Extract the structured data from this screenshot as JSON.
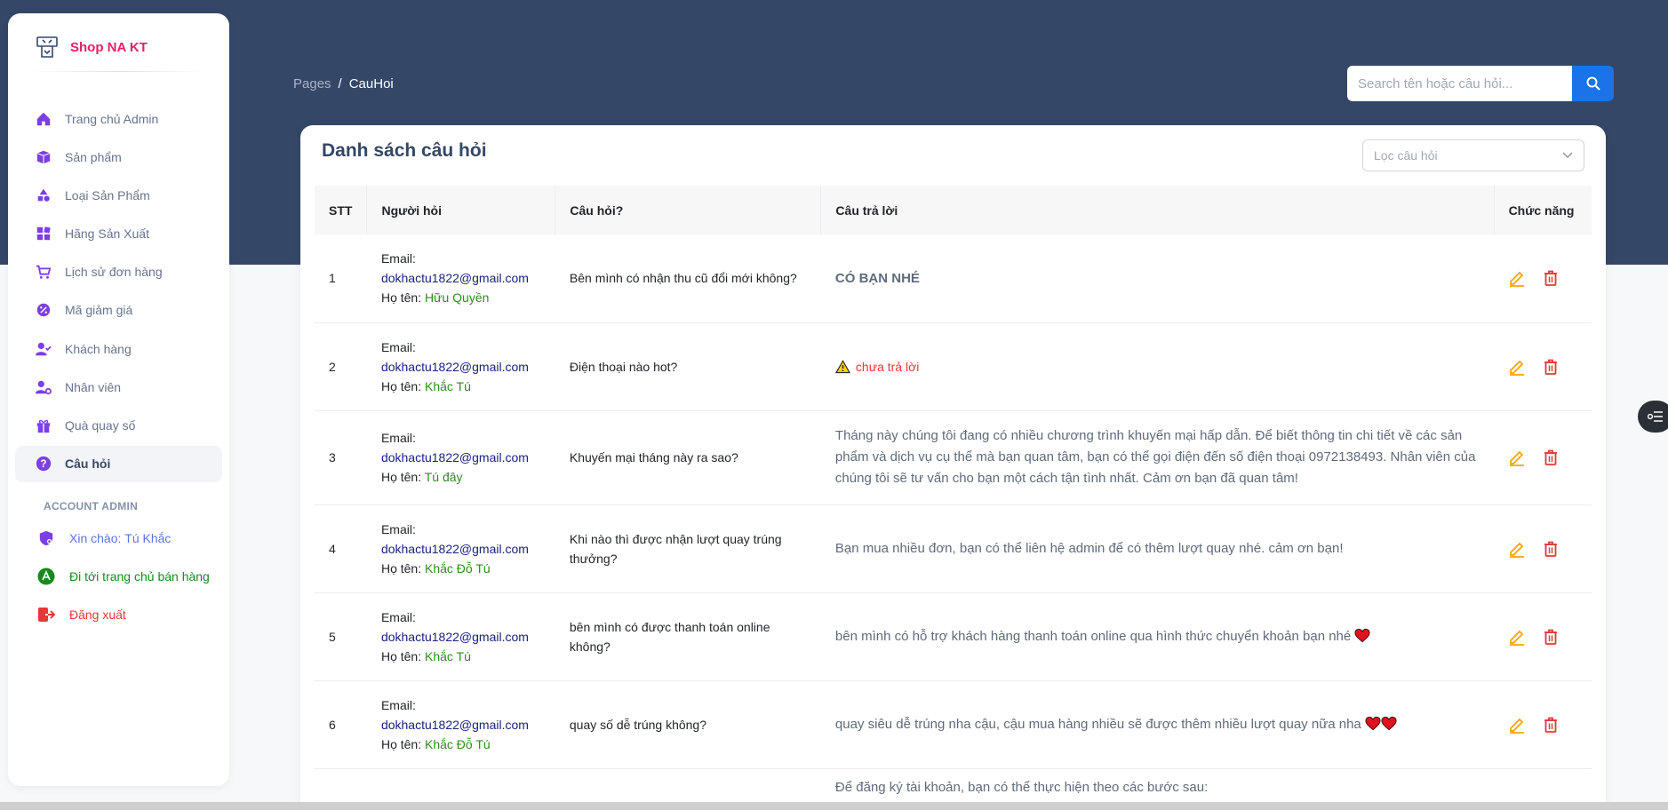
{
  "brand": {
    "name": "Shop NA KT"
  },
  "sidebar": {
    "items": [
      {
        "label": "Trang chủ Admin",
        "icon": "home-icon"
      },
      {
        "label": "Sản phẩm",
        "icon": "box-icon"
      },
      {
        "label": "Loại Sản Phẩm",
        "icon": "shapes-icon"
      },
      {
        "label": "Hãng Sản Xuất",
        "icon": "grid-icon"
      },
      {
        "label": "Lịch sử đơn hàng",
        "icon": "cart-icon"
      },
      {
        "label": "Mã giảm giá",
        "icon": "discount-icon"
      },
      {
        "label": "Khách hàng",
        "icon": "user-check-icon"
      },
      {
        "label": "Nhân viên",
        "icon": "user-gear-icon"
      },
      {
        "label": "Quà quay số",
        "icon": "gift-icon"
      },
      {
        "label": "Câu hỏi",
        "icon": "question-icon",
        "active": true
      }
    ],
    "account_section": "ACCOUNT ADMIN",
    "account": {
      "greeting_prefix": "Xin chào: ",
      "greeting_name": "Tú Khắc",
      "store_link": "Đi tới trang chủ bán hàng",
      "logout": "Đăng xuất"
    }
  },
  "breadcrumb": {
    "pages": "Pages",
    "sep": "/",
    "current": "CauHoi"
  },
  "search": {
    "placeholder": "Search tên hoặc câu hỏi..."
  },
  "card": {
    "title": "Danh sách câu hỏi",
    "filter_placeholder": "Lọc câu hỏi"
  },
  "table": {
    "headers": {
      "stt": "STT",
      "user": "Người hỏi",
      "question": "Câu hỏi?",
      "answer": "Câu trả lời",
      "actions": "Chức năng"
    },
    "email_label": "Email:",
    "name_label": "Họ tên: ",
    "rows": [
      {
        "stt": "1",
        "email": "dokhactu1822@gmail.com",
        "name": "Hữu Quyền",
        "question": "Bên mình có nhận thu cũ đổi mới không?",
        "answer": "CÓ BẠN NHÉ",
        "answer_type": "strong"
      },
      {
        "stt": "2",
        "email": "dokhactu1822@gmail.com",
        "name": "Khắc Tú",
        "question": "Điện thoại nào hot?",
        "answer": "chưa trả lời",
        "answer_type": "warning"
      },
      {
        "stt": "3",
        "email": "dokhactu1822@gmail.com",
        "name": "Tú đây",
        "question": "Khuyến mại tháng này ra sao?",
        "answer": "Tháng này chúng tôi đang có nhiều chương trình khuyến mại hấp dẫn. Để biết thông tin chi tiết về các sản phẩm và dịch vụ cụ thể mà bạn quan tâm, bạn có thể gọi điện đến số điện thoại 0972138493. Nhân viên của chúng tôi sẽ tư vấn cho bạn một cách tận tình nhất. Cảm ơn bạn đã quan tâm!",
        "answer_type": "text"
      },
      {
        "stt": "4",
        "email": "dokhactu1822@gmail.com",
        "name": "Khắc Đỗ Tú",
        "question": "Khi nào thì được nhận lượt quay trúng thưởng?",
        "answer": "Bạn mua nhiều đơn, bạn có thể liên hệ admin để có thêm lượt quay nhé. cảm ơn bạn!",
        "answer_type": "text"
      },
      {
        "stt": "5",
        "email": "dokhactu1822@gmail.com",
        "name": "Khắc Tú",
        "question": "bên mình có được thanh toán online không?",
        "answer": "bên mình có hỗ trợ khách hàng thanh toán online qua hình thức chuyển khoản bạn nhé",
        "answer_type": "text",
        "hearts": 1
      },
      {
        "stt": "6",
        "email": "dokhactu1822@gmail.com",
        "name": "Khắc Đỗ Tú",
        "question": "quay số dễ trúng không?",
        "answer": "quay siêu dễ trúng nha cậu, cậu mua hàng nhiều sẽ được thêm nhiều lượt quay nữa nha",
        "answer_type": "text",
        "hearts": 2
      },
      {
        "stt": "",
        "email": "",
        "name": "",
        "question": "",
        "answer": "Để đăng ký tài khoản, bạn có thể thực hiện theo các bước sau:",
        "answer_type": "partial"
      }
    ]
  },
  "colors": {
    "hero": "#344767",
    "accent": "#1a73e8",
    "brand": "#e91e63",
    "edit": "#f5a300",
    "delete": "#e53935",
    "name": "#2e8b1e",
    "email": "#1a237e"
  }
}
